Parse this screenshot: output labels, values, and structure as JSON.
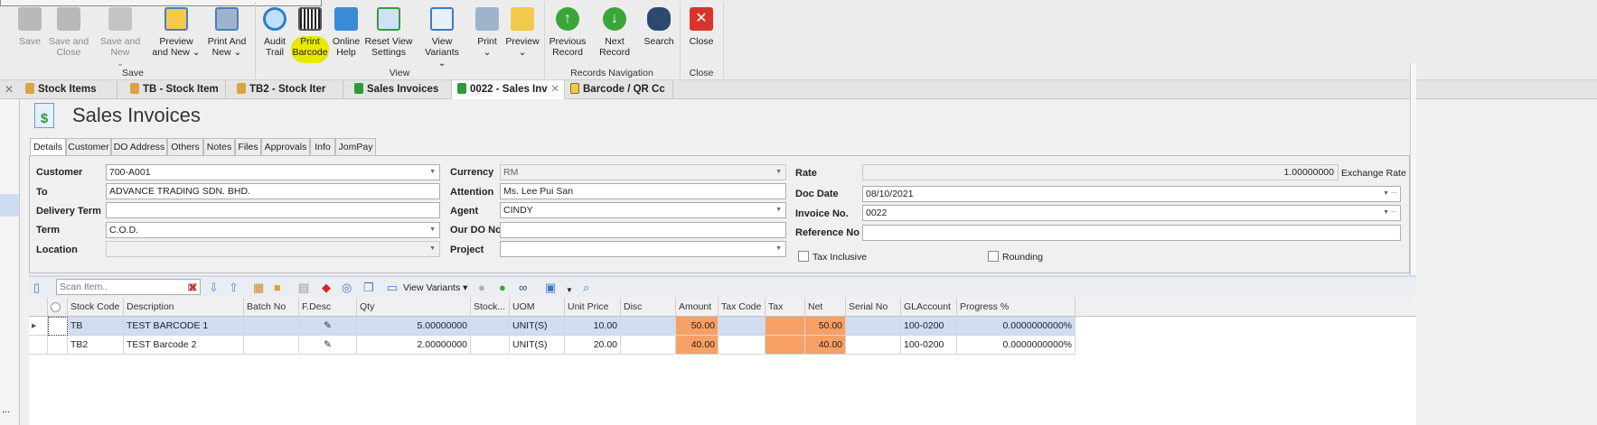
{
  "ribbon": {
    "groups": [
      {
        "label": "Save",
        "buttons": [
          {
            "label": "Save",
            "enabled": false
          },
          {
            "label": "Save and Close",
            "enabled": false
          },
          {
            "label": "Save and New",
            "enabled": false
          },
          {
            "label": "Preview and New",
            "enabled": true
          },
          {
            "label": "Print And New",
            "enabled": true
          }
        ]
      },
      {
        "label": "View",
        "buttons": [
          {
            "label": "Audit Trail"
          },
          {
            "label": "Print Barcode",
            "highlight": "#e8e800"
          },
          {
            "label": "Online Help"
          },
          {
            "label": "Reset View Settings"
          },
          {
            "label": "View Variants"
          },
          {
            "label": "Print"
          },
          {
            "label": "Preview"
          }
        ]
      },
      {
        "label": "Records Navigation",
        "buttons": [
          {
            "label": "Previous Record"
          },
          {
            "label": "Next Record"
          },
          {
            "label": "Search"
          }
        ]
      },
      {
        "label": "Close",
        "buttons": [
          {
            "label": "Close"
          }
        ]
      }
    ]
  },
  "doc_tabs": [
    {
      "label": "Stock Items",
      "icon": "box-icon"
    },
    {
      "label": "TB - Stock Item",
      "icon": "box-icon"
    },
    {
      "label": "TB2 - Stock Iter",
      "icon": "box-icon"
    },
    {
      "label": "Sales Invoices",
      "icon": "dollar-doc-icon"
    },
    {
      "label": "0022 - Sales Inv",
      "icon": "dollar-doc-icon",
      "active": true
    },
    {
      "label": "Barcode / QR Cc",
      "icon": "clipboard-icon"
    }
  ],
  "page_title": "Sales Invoices",
  "sub_tabs": [
    "Details",
    "Customer",
    "DO Address",
    "Others",
    "Notes",
    "Files",
    "Approvals",
    "Info",
    "JomPay"
  ],
  "form": {
    "customer_label": "Customer",
    "customer": "700-A001",
    "to_label": "To",
    "to": "ADVANCE TRADING SDN. BHD.",
    "delivery_term_label": "Delivery Term",
    "delivery_term": "",
    "term_label": "Term",
    "term": "C.O.D.",
    "location_label": "Location",
    "location": "",
    "currency_label": "Currency",
    "currency": "RM",
    "attention_label": "Attention",
    "attention": "Ms. Lee Pui San",
    "agent_label": "Agent",
    "agent": "CINDY",
    "our_do_label": "Our DO No",
    "our_do": "",
    "project_label": "Project",
    "project": "",
    "rate_label": "Rate",
    "rate": "1.00000000",
    "exchange_rate_label": "Exchange Rate",
    "doc_date_label": "Doc Date",
    "doc_date": "08/10/2021",
    "invoice_no_label": "Invoice No.",
    "invoice_no": "0022",
    "reference_label": "Reference No",
    "reference": "",
    "tax_inclusive_label": "Tax Inclusive",
    "tax_inclusive": false,
    "rounding_label": "Rounding",
    "rounding": false
  },
  "grid_toolbar": {
    "scan_placeholder": "Scan Item..",
    "view_variants": "View Variants"
  },
  "grid": {
    "columns": [
      "Stock Code",
      "Description",
      "Batch No",
      "F.Desc",
      "Qty",
      "Stock...",
      "UOM",
      "Unit Price",
      "Disc",
      "Amount",
      "Tax Code",
      "Tax",
      "Net",
      "Serial No",
      "GLAccount",
      "Progress %"
    ],
    "rows": [
      {
        "stock_code": "TB",
        "description": "TEST BARCODE 1",
        "batch": "",
        "qty": "5.00000000",
        "stock": "",
        "uom": "UNIT(S)",
        "unit_price": "10.00",
        "disc": "",
        "amount": "50.00",
        "tax_code": "",
        "tax": "",
        "net": "50.00",
        "serial": "",
        "gl": "100-0200",
        "progress": "0.0000000000%"
      },
      {
        "stock_code": "TB2",
        "description": "TEST Barcode 2",
        "batch": "",
        "qty": "2.00000000",
        "stock": "",
        "uom": "UNIT(S)",
        "unit_price": "20.00",
        "disc": "",
        "amount": "40.00",
        "tax_code": "",
        "tax": "",
        "net": "40.00",
        "serial": "",
        "gl": "100-0200",
        "progress": "0.0000000000%"
      }
    ]
  },
  "sidebar": {
    "more": "..."
  }
}
